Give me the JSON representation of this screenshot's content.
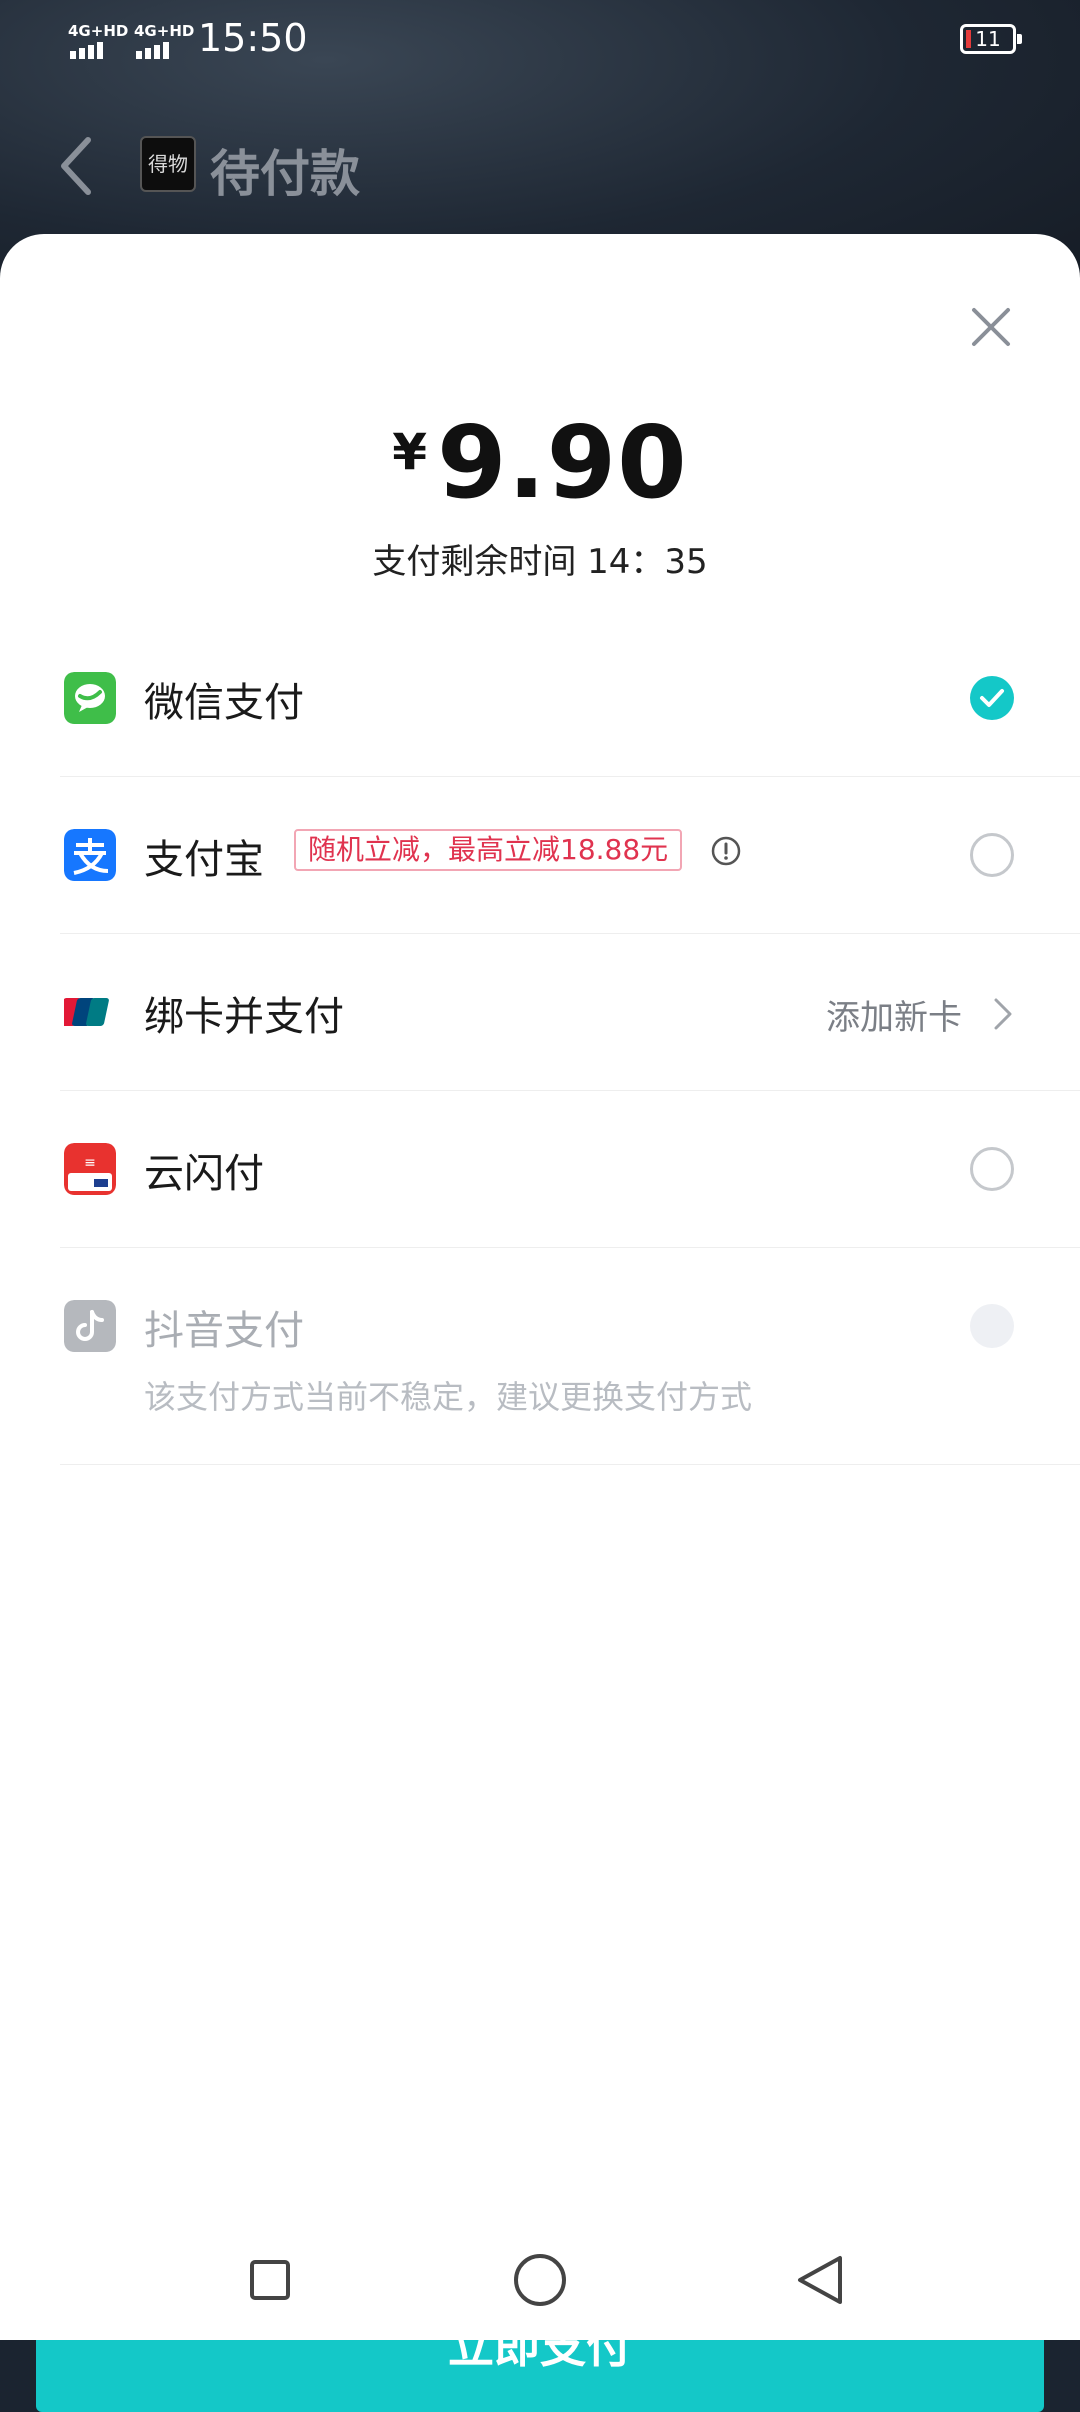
{
  "status_bar": {
    "network_1": "4G+HD",
    "network_2": "4G+HD",
    "time": "15:50",
    "battery": "11"
  },
  "header": {
    "logo_text": "得物",
    "title": "待付款"
  },
  "sheet": {
    "amount_currency": "¥",
    "amount_value": "9.90",
    "countdown_label": "支付剩余时间 14：35"
  },
  "payment_methods": [
    {
      "label": "微信支付",
      "icon": "wechat-pay-icon",
      "selected": true
    },
    {
      "label": "支付宝",
      "icon": "alipay-icon",
      "promo": "随机立减，最高立减18.88元",
      "selected": false
    },
    {
      "label": "绑卡并支付",
      "icon": "unionpay-icon",
      "action": "添加新卡"
    },
    {
      "label": "云闪付",
      "icon": "cloud-quickpass-icon",
      "selected": false
    },
    {
      "label": "抖音支付",
      "icon": "douyin-pay-icon",
      "disabled": true,
      "note": "该支付方式当前不稳定，建议更换支付方式"
    }
  ],
  "footer": {
    "pay_button": "立即支付"
  },
  "colors": {
    "accent": "#14c8c8",
    "promo": "#e0334f",
    "wechat": "#3fbe49",
    "alipay": "#1677ff"
  }
}
